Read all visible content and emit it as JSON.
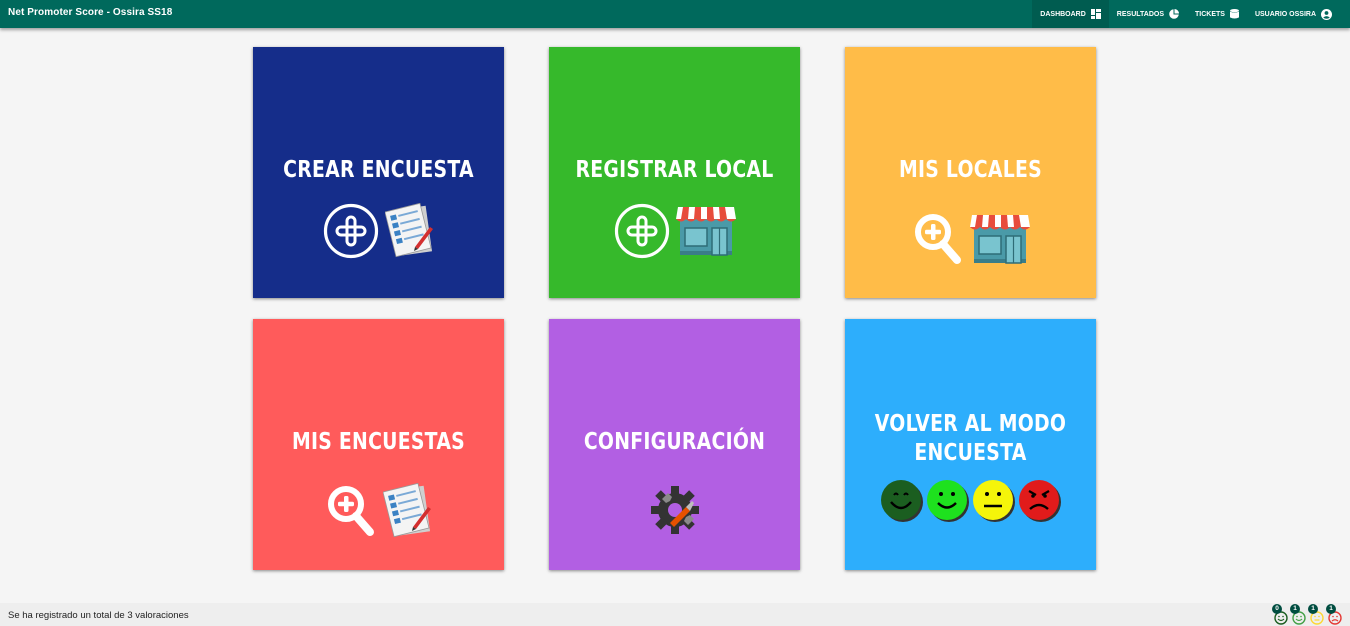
{
  "header": {
    "title": "Net Promoter Score - Ossira SS18",
    "nav": [
      {
        "label": "DASHBOARD",
        "icon": "dashboard-icon"
      },
      {
        "label": "RESULTADOS",
        "icon": "pie-chart-icon"
      },
      {
        "label": "TICKETS",
        "icon": "database-icon"
      },
      {
        "label": "USUARIO OSSIRA",
        "icon": "account-circle-icon"
      }
    ]
  },
  "tiles": [
    {
      "label": "CREAR ENCUESTA",
      "color": "#152d8a",
      "icons": [
        "plus-circle-icon",
        "survey-document-icon"
      ]
    },
    {
      "label": "REGISTRAR LOCAL",
      "color": "#36b92b",
      "icons": [
        "plus-circle-icon",
        "shop-icon"
      ]
    },
    {
      "label": "MIS LOCALES",
      "color": "#ffbc48",
      "icons": [
        "zoom-in-icon",
        "shop-icon"
      ]
    },
    {
      "label": "MIS ENCUESTAS",
      "color": "#ff5b5b",
      "icons": [
        "zoom-in-icon",
        "survey-document-icon"
      ]
    },
    {
      "label": "CONFIGURACIÓN",
      "color": "#b25fe3",
      "icons": [
        "settings-gear-wrench-icon"
      ]
    },
    {
      "label_line1": "VOLVER AL MODO",
      "label_line2": "ENCUESTA",
      "color": "#2daefc",
      "icons": [
        "very-happy-face-icon",
        "happy-face-icon",
        "neutral-face-icon",
        "angry-face-icon"
      ]
    }
  ],
  "footer": {
    "summary": "Se ha registrado un total de 3 valoraciones",
    "counters": [
      {
        "count": "0",
        "icon": "very-happy-face-icon",
        "color": "#1b5e20"
      },
      {
        "count": "1",
        "icon": "happy-face-icon",
        "color": "#43a047"
      },
      {
        "count": "1",
        "icon": "neutral-face-icon",
        "color": "#fdd835"
      },
      {
        "count": "1",
        "icon": "angry-face-icon",
        "color": "#e53935"
      }
    ]
  }
}
